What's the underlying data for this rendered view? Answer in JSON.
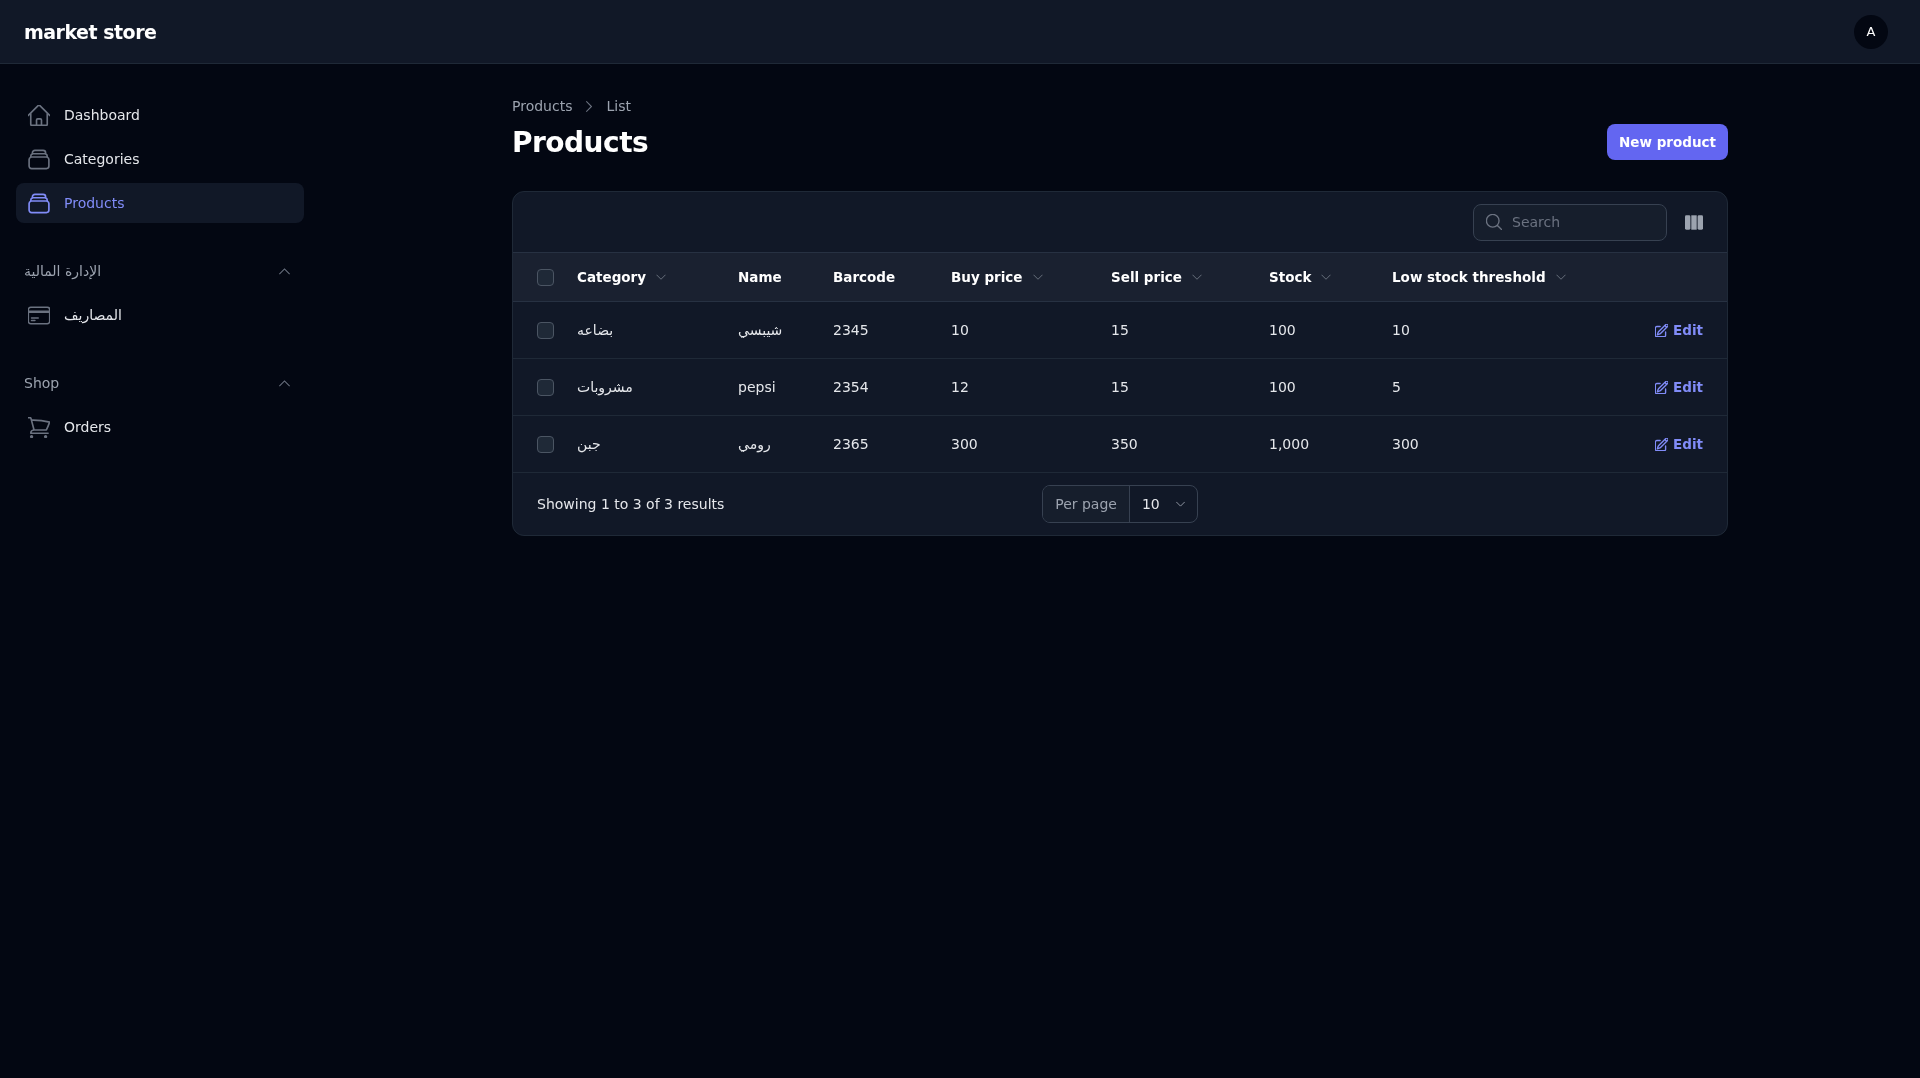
{
  "topbar": {
    "logo": "market store",
    "avatar": "A"
  },
  "sidebar": {
    "groups": [
      {
        "items": [
          {
            "label": "Dashboard",
            "selected": false
          },
          {
            "label": "Categories",
            "selected": false
          },
          {
            "label": "Products",
            "selected": true
          }
        ]
      },
      {
        "label": "الإدارة المالية",
        "expanded": true,
        "items": [
          {
            "label": "المصاريف",
            "selected": false
          }
        ]
      },
      {
        "label": "Shop",
        "expanded": true,
        "items": [
          {
            "label": "Orders",
            "selected": false
          }
        ]
      }
    ]
  },
  "breadcrumbs": [
    "Products",
    "List"
  ],
  "title": "Products",
  "new_button": "New product",
  "table": {
    "search": {
      "placeholder": "Search"
    },
    "select_all": {
      "checked": false
    },
    "columns": [
      {
        "label": "Category",
        "sortable": true
      },
      {
        "label": "Name",
        "sortable": false
      },
      {
        "label": "Barcode",
        "sortable": false
      },
      {
        "label": "Buy price",
        "sortable": true
      },
      {
        "label": "Sell price",
        "sortable": true
      },
      {
        "label": "Stock",
        "sortable": true
      },
      {
        "label": "Low stock threshold",
        "sortable": true
      }
    ],
    "rows": [
      {
        "checked": false,
        "cells": [
          "بضاعه",
          "شيبسي",
          "2345",
          "10",
          "15",
          "100",
          "10"
        ],
        "action": "Edit"
      },
      {
        "checked": false,
        "cells": [
          "مشروبات",
          "pepsi",
          "2354",
          "12",
          "15",
          "100",
          "5"
        ],
        "action": "Edit"
      },
      {
        "checked": false,
        "cells": [
          "جبن",
          "رومي",
          "2365",
          "300",
          "350",
          "1,000",
          "300"
        ],
        "action": "Edit"
      }
    ],
    "footer": {
      "summary": "Showing 1 to 3 of 3 results",
      "per_page_label": "Per page",
      "per_page_value": "10"
    }
  }
}
